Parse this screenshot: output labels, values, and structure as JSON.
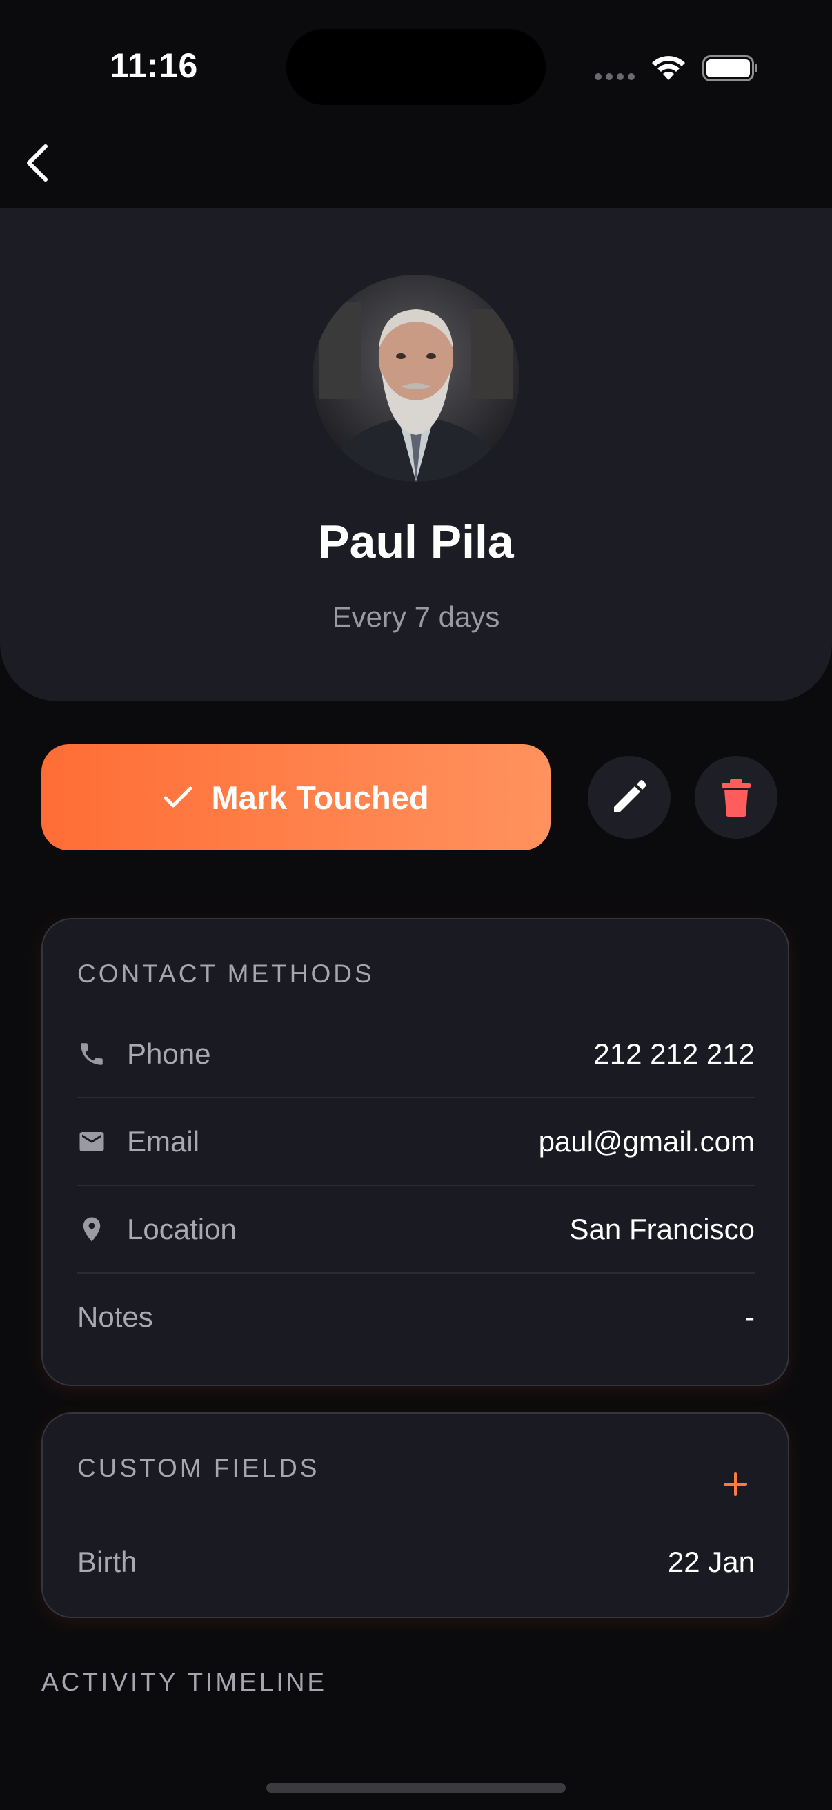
{
  "status_bar": {
    "time": "11:16"
  },
  "icons": {
    "back": "chevron-left-icon",
    "wifi": "wifi-icon",
    "battery": "battery-icon",
    "check": "checkmark-icon",
    "edit": "pencil-icon",
    "delete": "trash-icon",
    "phone": "phone-icon",
    "email": "mail-icon",
    "location": "map-pin-icon",
    "add": "plus-icon"
  },
  "colors": {
    "accent": "#ff7a3d",
    "delete": "#ff5c5c",
    "background": "#0b0b0d",
    "card": "#1a1b22"
  },
  "profile": {
    "name": "Paul Pila",
    "frequency": "Every 7 days"
  },
  "actions": {
    "mark_label": "Mark Touched"
  },
  "contact_methods": {
    "title": "CONTACT METHODS",
    "rows": [
      {
        "label": "Phone",
        "value": "212 212 212"
      },
      {
        "label": "Email",
        "value": "paul@gmail.com"
      },
      {
        "label": "Location",
        "value": "San Francisco"
      },
      {
        "label": "Notes",
        "value": "-"
      }
    ]
  },
  "custom_fields": {
    "title": "CUSTOM FIELDS",
    "rows": [
      {
        "label": "Birth",
        "value": "22 Jan"
      }
    ]
  },
  "activity": {
    "title": "ACTIVITY TIMELINE"
  }
}
